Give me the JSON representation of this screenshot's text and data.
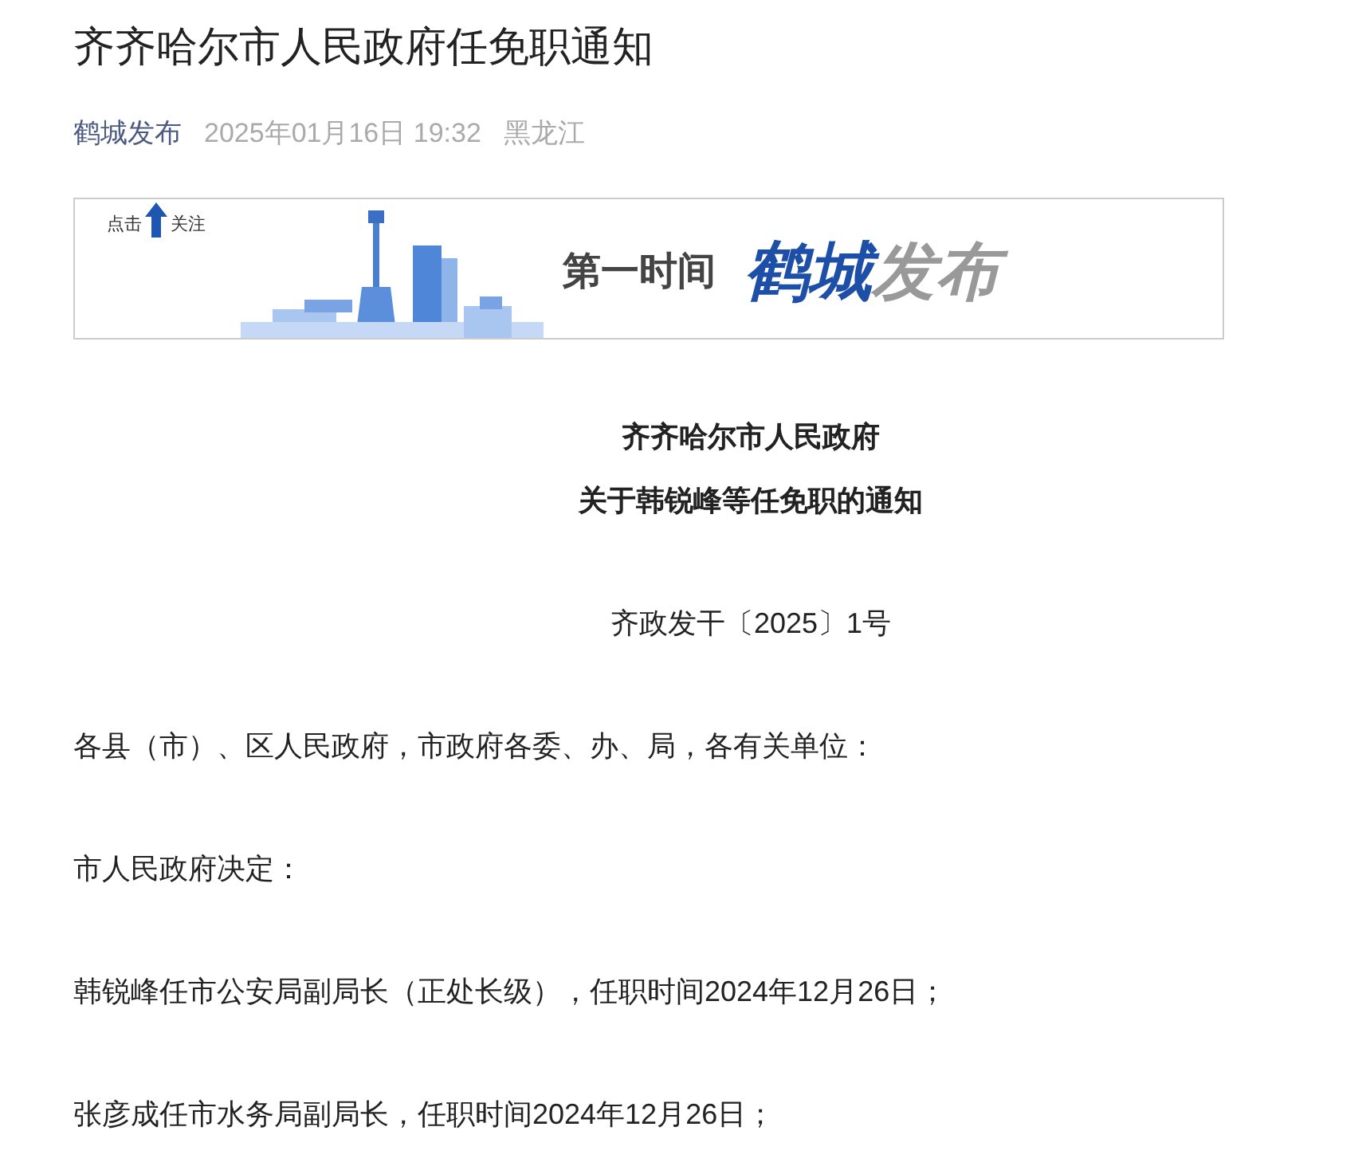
{
  "article": {
    "title": "齐齐哈尔市人民政府任免职通知",
    "source": "鹤城发布",
    "time": "2025年01月16日 19:32",
    "region": "黑龙江"
  },
  "banner": {
    "follow_left": "点击",
    "follow_right": "关注",
    "slogan": "第一时间",
    "brand_primary": "鹤城",
    "brand_secondary": "发布"
  },
  "document": {
    "heading": [
      "齐齐哈尔市人民政府",
      "关于韩锐峰等任免职的通知"
    ],
    "number": "齐政发干〔2025〕1号",
    "paragraphs": [
      "各县（市）、区人民政府，市政府各委、办、局，各有关单位：",
      "市人民政府决定：",
      "韩锐峰任市公安局副局长（正处长级），任职时间2024年12月26日；",
      "张彦成任市水务局副局长，任职时间2024年12月26日；"
    ]
  }
}
